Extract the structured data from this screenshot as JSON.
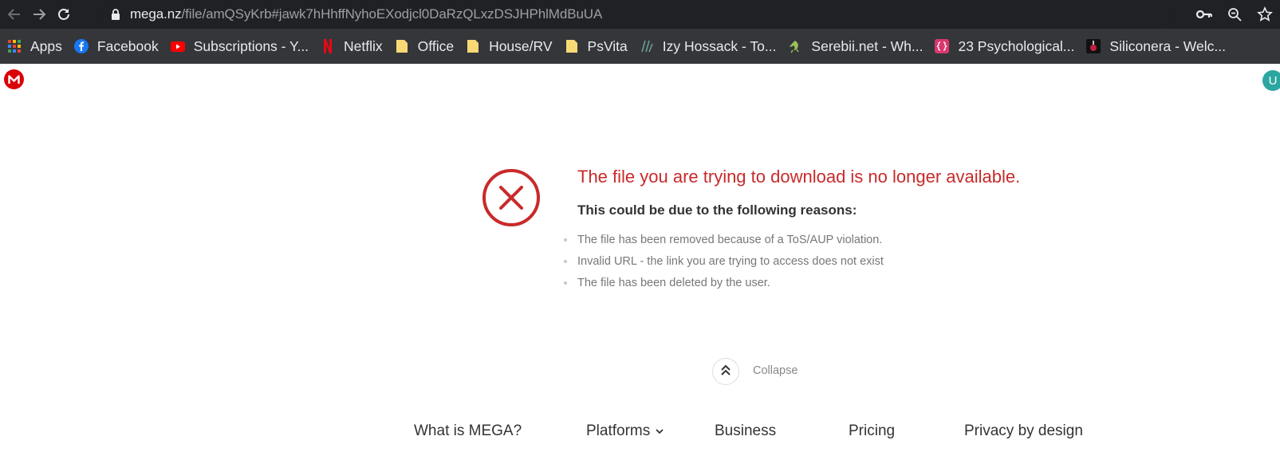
{
  "browser": {
    "url_host": "mega.nz",
    "url_path": "/file/amQSyKrb#jawk7hHhffNyhoEXodjcl0DaRzQLxzDSJHPhlMdBuUA",
    "icons": [
      "back-arrow-icon",
      "forward-arrow-icon",
      "reload-icon",
      "lock-icon",
      "key-icon",
      "zoom-icon",
      "star-icon"
    ]
  },
  "bookmarks": [
    {
      "label": "Apps",
      "icon": "apps-grid-icon"
    },
    {
      "label": "Facebook",
      "icon": "facebook-icon"
    },
    {
      "label": "Subscriptions - Y...",
      "icon": "youtube-icon"
    },
    {
      "label": "Netflix",
      "icon": "netflix-icon"
    },
    {
      "label": "Office",
      "icon": "folder-icon"
    },
    {
      "label": "House/RV",
      "icon": "folder-icon"
    },
    {
      "label": "PsVita",
      "icon": "folder-icon"
    },
    {
      "label": "Izy Hossack - To...",
      "icon": "site-icon"
    },
    {
      "label": "Serebii.net - Wh...",
      "icon": "serebii-icon"
    },
    {
      "label": "23 Psychological...",
      "icon": "braces-icon"
    },
    {
      "label": "Siliconera - Welc...",
      "icon": "siliconera-icon"
    }
  ],
  "page": {
    "avatar_initial": "U",
    "error": {
      "title": "The file you are trying to download is no longer available.",
      "subtitle": "This could be due to the following reasons:",
      "reasons": [
        "The file has been removed because of a ToS/AUP violation.",
        "Invalid URL - the link you are trying to access does not exist",
        "The file has been deleted by the user."
      ]
    },
    "collapse_label": "Collapse",
    "footer_nav": [
      "What is MEGA?",
      "Platforms",
      "Business",
      "Pricing",
      "Privacy by design"
    ]
  },
  "colors": {
    "chrome_bg": "#202124",
    "bookmarks_bg": "#35363a",
    "mega_red": "#d90007",
    "error_red": "#c92a2a",
    "avatar_teal": "#2ba6a0"
  }
}
